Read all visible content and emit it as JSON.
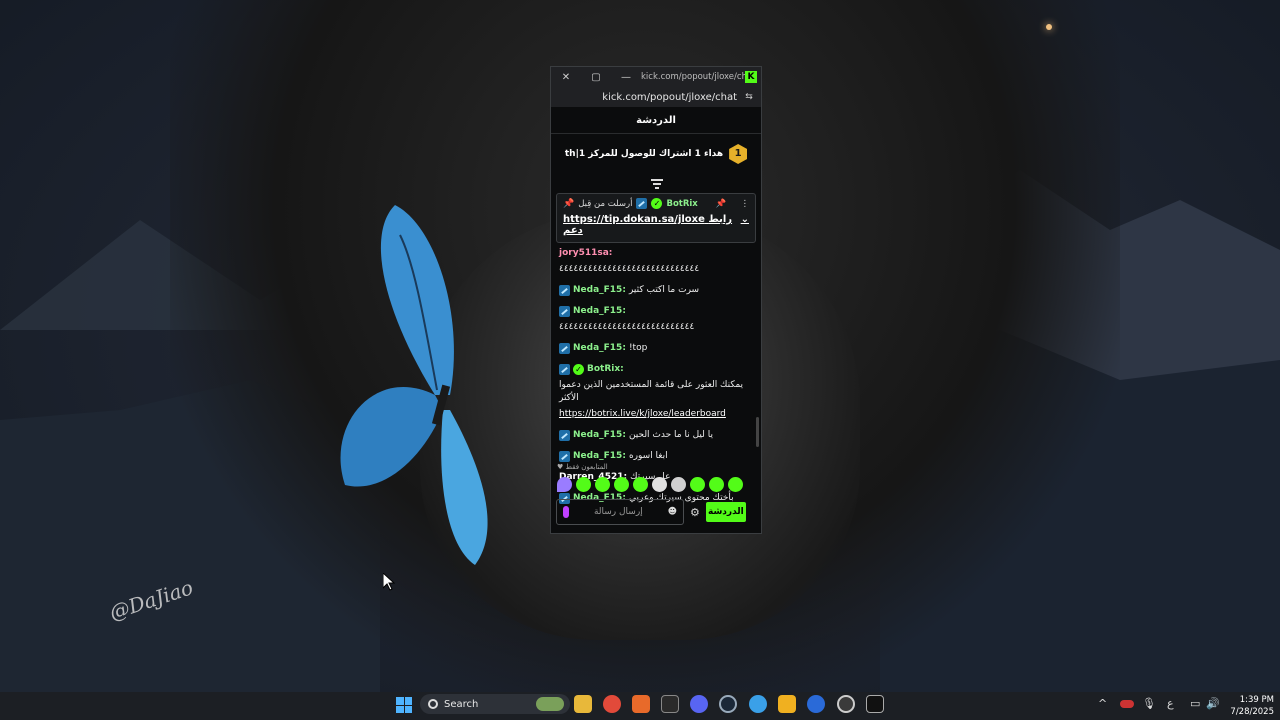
{
  "window": {
    "title": "kick.com/popout/jloxe/chat",
    "url": "kick.com/popout/jloxe/chat",
    "close_glyph": "✕",
    "maximize_glyph": "▢",
    "minimize_glyph": "—"
  },
  "chat": {
    "header": "الدردشة",
    "goal_rank": "1",
    "goal_text": "th|هداء 1 اشتراك للوصول للمركز 1",
    "pinned": {
      "sender_label": "أرسلت من قِبل",
      "user": "BotRix",
      "link": "https://tip.dokan.sa/jloxe",
      "link_label": "رابط دعم"
    },
    "messages": [
      {
        "user": "jory511sa:",
        "text": "٤٤٤٤٤٤٤٤٤٤٤٤٤٤٤٤٤٤٤٤٤٤٤٤٤٤٤٤٤",
        "color": "pink",
        "badge": false,
        "verified": false
      },
      {
        "user": "Neda_F15:",
        "text": "سرت ما اكتب كثير",
        "color": "green",
        "badge": true,
        "verified": false
      },
      {
        "user": "Neda_F15:",
        "text": "٤٤٤٤٤٤٤٤٤٤٤٤٤٤٤٤٤٤٤٤٤٤٤٤٤٤٤٤",
        "color": "green",
        "badge": true,
        "verified": false
      },
      {
        "user": "Neda_F15:",
        "text": "!top",
        "color": "green",
        "badge": true,
        "verified": false
      },
      {
        "user": "BotRix:",
        "text": "يمكنك العثور على قائمة المستخدمين الذين دعموا الأكثر",
        "link": "https://botrix.live/k/jloxe/leaderboard",
        "color": "green",
        "badge": true,
        "verified": true
      },
      {
        "user": "Neda_F15:",
        "text": "يا ليل نا ما حدث الحين",
        "color": "green",
        "badge": true,
        "verified": false
      },
      {
        "user": "Neda_F15:",
        "text": "ابغا اسوره",
        "color": "green",
        "badge": true,
        "verified": false
      },
      {
        "user": "Darren_4521:",
        "text": "عل سيرتك",
        "color": "white",
        "badge": false,
        "verified": false
      },
      {
        "user": "Neda_F15:",
        "text": "بأختك محتوى سيرتك وعربي",
        "color": "green",
        "badge": true,
        "verified": false
      }
    ],
    "followers_only": "المتابعون فقط",
    "input_placeholder": "إرسال رسالة",
    "send_button": "الدردشة"
  },
  "wallpaper": {
    "signature": "@DaJiao"
  },
  "taskbar": {
    "search_label": "Search",
    "time": "1:39 PM",
    "date": "7/28/2025",
    "lang_indicator": "ع"
  },
  "colors": {
    "kick_green": "#53fc18",
    "taskbar": "#1c1f24"
  }
}
